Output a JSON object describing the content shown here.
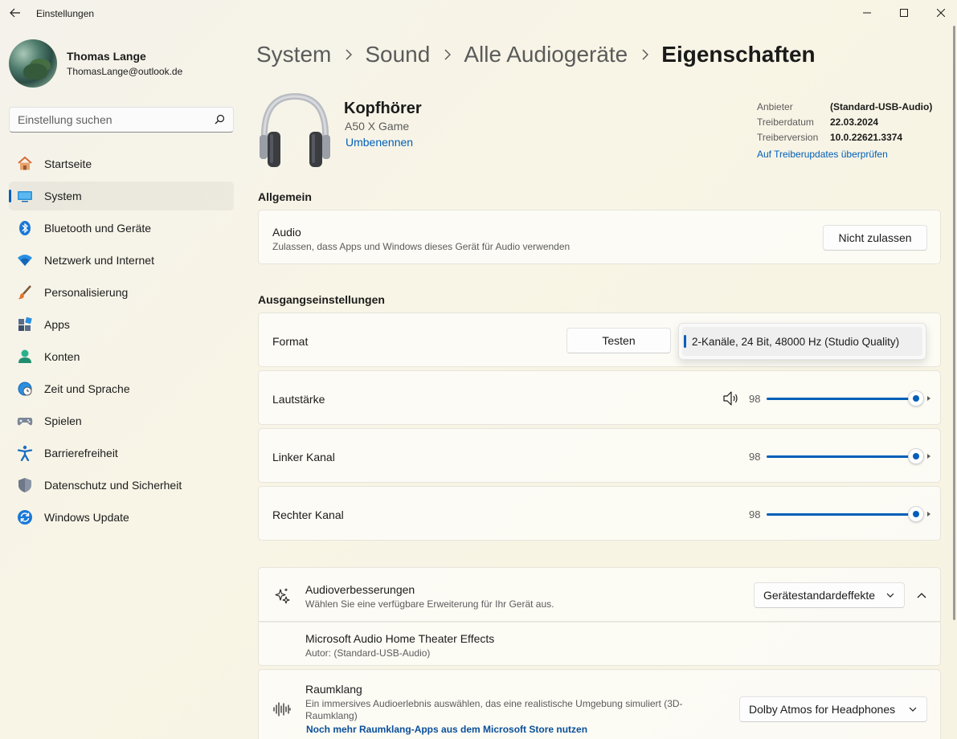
{
  "window": {
    "title": "Einstellungen"
  },
  "profile": {
    "name": "Thomas Lange",
    "email": "ThomasLange@outlook.de"
  },
  "search": {
    "placeholder": "Einstellung suchen"
  },
  "nav": {
    "items": [
      {
        "label": "Startseite",
        "icon": "home-icon",
        "active": false
      },
      {
        "label": "System",
        "icon": "system-icon",
        "active": true
      },
      {
        "label": "Bluetooth und Geräte",
        "icon": "bluetooth-icon",
        "active": false
      },
      {
        "label": "Netzwerk und Internet",
        "icon": "wifi-icon",
        "active": false
      },
      {
        "label": "Personalisierung",
        "icon": "brush-icon",
        "active": false
      },
      {
        "label": "Apps",
        "icon": "apps-icon",
        "active": false
      },
      {
        "label": "Konten",
        "icon": "account-icon",
        "active": false
      },
      {
        "label": "Zeit und Sprache",
        "icon": "globe-clock-icon",
        "active": false
      },
      {
        "label": "Spielen",
        "icon": "gamepad-icon",
        "active": false
      },
      {
        "label": "Barrierefreiheit",
        "icon": "accessibility-icon",
        "active": false
      },
      {
        "label": "Datenschutz und Sicherheit",
        "icon": "shield-icon",
        "active": false
      },
      {
        "label": "Windows Update",
        "icon": "update-icon",
        "active": false
      }
    ]
  },
  "breadcrumb": {
    "items": [
      "System",
      "Sound",
      "Alle Audiogeräte"
    ],
    "current": "Eigenschaften"
  },
  "device": {
    "name": "Kopfhörer",
    "model": "A50 X Game",
    "rename": "Umbenennen",
    "info": {
      "vendor_label": "Anbieter",
      "vendor": "(Standard-USB-Audio)",
      "date_label": "Treiberdatum",
      "date": "22.03.2024",
      "version_label": "Treiberversion",
      "version": "10.0.22621.3374",
      "update_link": "Auf Treiberupdates überprüfen"
    }
  },
  "general": {
    "title": "Allgemein",
    "audio_title": "Audio",
    "audio_sub": "Zulassen, dass Apps und Windows dieses Gerät für Audio verwenden",
    "audio_button": "Nicht zulassen"
  },
  "output": {
    "title": "Ausgangseinstellungen",
    "format_label": "Format",
    "test_button": "Testen",
    "format_selected": "2-Kanäle, 24 Bit, 48000 Hz (Studio Quality)",
    "volume_label": "Lautstärke",
    "volume": "98",
    "left_label": "Linker Kanal",
    "left": "98",
    "right_label": "Rechter Kanal",
    "right": "98",
    "level_fraction": 0.98
  },
  "enhancements": {
    "title": "Audioverbesserungen",
    "sub": "Wählen Sie eine verfügbare Erweiterung für Ihr Gerät aus.",
    "dropdown": "Gerätestandardeffekte",
    "effect_title": "Microsoft Audio Home Theater Effects",
    "effect_sub": "Autor: (Standard-USB-Audio)"
  },
  "spatial": {
    "title": "Raumklang",
    "sub1": "Ein immersives Audioerlebnis auswählen, das eine realistische Umgebung simuliert (3D-",
    "sub2": "Raumklang)",
    "link": "Noch mehr Raumklang-Apps aus dem Microsoft Store nutzen",
    "dropdown": "Dolby Atmos for Headphones"
  },
  "colors": {
    "accent": "#005fb8"
  }
}
